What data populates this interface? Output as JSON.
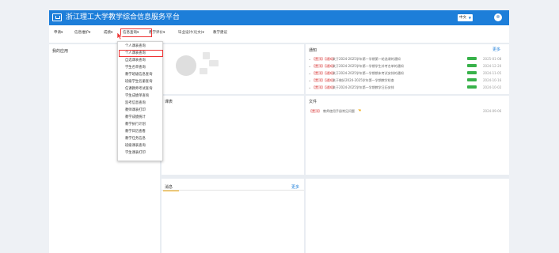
{
  "header": {
    "title": "浙江理工大学教学综合信息服务平台",
    "language": "中文",
    "brand_color": "#1d7ed9"
  },
  "menu": [
    {
      "label": "申请▾"
    },
    {
      "label": "信息维护▾"
    },
    {
      "label": "成绩▾"
    },
    {
      "label": "信息查询▾"
    },
    {
      "label": "教学评价▾"
    },
    {
      "label": "毕业设计(论文)▾"
    },
    {
      "label": "教学建议"
    }
  ],
  "dropdown": {
    "items": [
      {
        "label": "个人课表查询"
      },
      {
        "label": "个人课表查询"
      },
      {
        "label": "自选课表查询"
      },
      {
        "label": "学生名单查询"
      },
      {
        "label": "教学班级信息查询"
      },
      {
        "label": "班级学生名册查询"
      },
      {
        "label": "任课教师考试查询"
      },
      {
        "label": "学生成绩单查询"
      },
      {
        "label": "监考信息查询"
      },
      {
        "label": "教师课表打印"
      },
      {
        "label": "教学成绩统计"
      },
      {
        "label": "教学执行计划"
      },
      {
        "label": "教学日历查看"
      },
      {
        "label": "教学任务信息"
      },
      {
        "label": "班级课表查询"
      },
      {
        "label": "学生课表打印"
      }
    ]
  },
  "panels": {
    "quick_apps": {
      "title": "我的应用"
    },
    "notices": {
      "title": "通知",
      "more": "更多",
      "rows": [
        {
          "tag": "【置顶】【通知】",
          "text": "关于2024-2025学年第一学期第一轮选课的通知",
          "date": "2025-01-08"
        },
        {
          "tag": "【置顶】【通知】",
          "text": "关于2024-2025学年第一学期学生补考名单的通知",
          "date": "2024-12-20"
        },
        {
          "tag": "【置顶】【通知】",
          "text": "关于2024-2025学年第一学期期末考试安排的通知",
          "date": "2024-11-05"
        },
        {
          "tag": "【置顶】【通知】",
          "text": "关于做好2024-2025学年第一学期教学检查",
          "date": "2024-10-16"
        },
        {
          "tag": "【置顶】【通知】",
          "text": "关于2024-2025学年第一学期教学日历安排",
          "date": "2024-10-02"
        }
      ]
    },
    "schedule": {
      "title": "课表"
    },
    "files": {
      "title": "文件",
      "rows": [
        {
          "tag": "【置顶】",
          "text": "教师使用手册常见问题",
          "date": "2024-09-06"
        }
      ]
    },
    "messages": {
      "title": "消息",
      "more": "更多"
    }
  }
}
